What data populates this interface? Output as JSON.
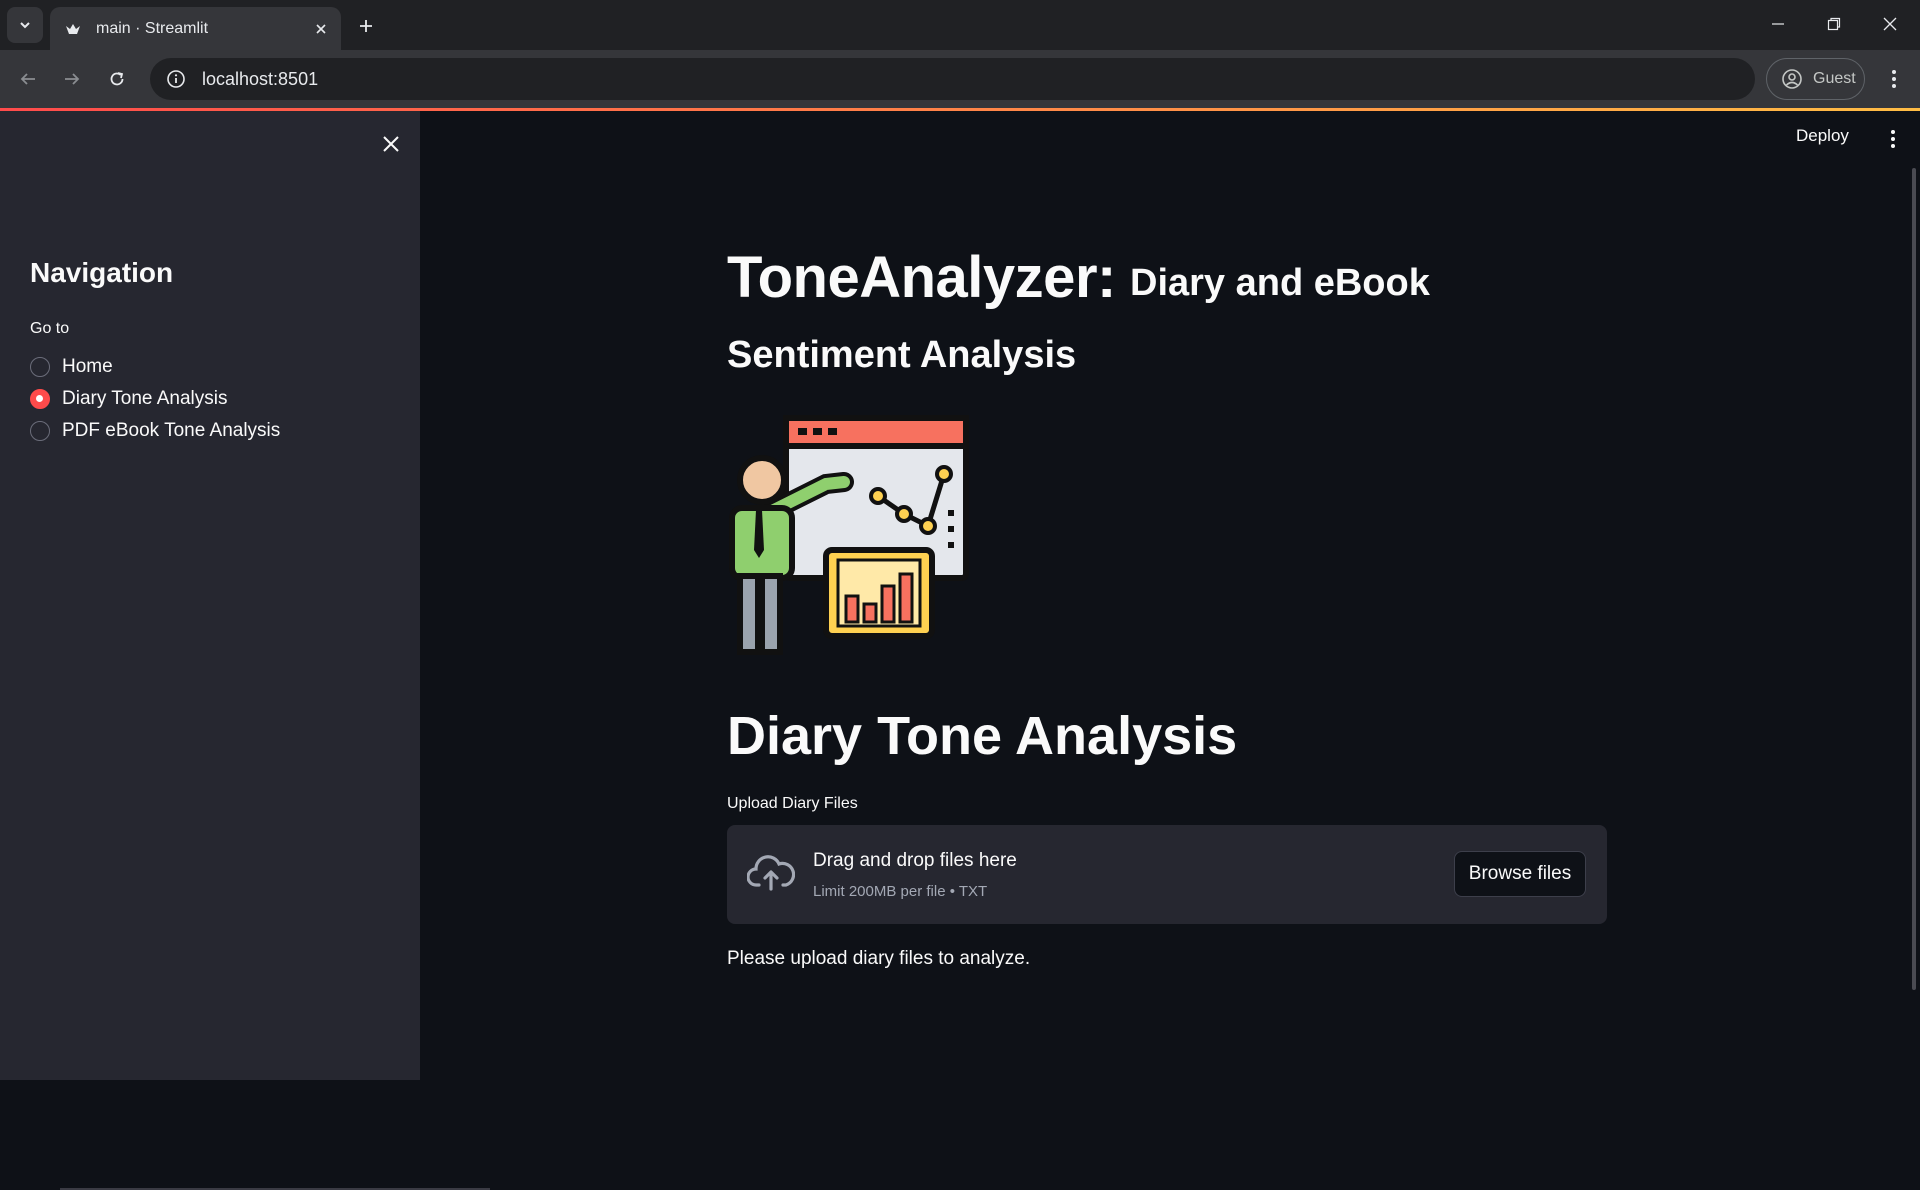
{
  "browser": {
    "tab_title": "main · Streamlit",
    "url": "localhost:8501",
    "profile_label": "Guest"
  },
  "sidebar": {
    "heading": "Navigation",
    "radio_label": "Go to",
    "options": [
      {
        "label": "Home",
        "selected": false
      },
      {
        "label": "Diary Tone Analysis",
        "selected": true
      },
      {
        "label": "PDF eBook Tone Analysis",
        "selected": false
      }
    ]
  },
  "header": {
    "deploy_label": "Deploy"
  },
  "main": {
    "title": "ToneAnalyzer:",
    "title_suffix": "Diary and eBook",
    "subtitle": "Sentiment Analysis",
    "section_title": "Diary Tone Analysis",
    "uploader": {
      "label": "Upload Diary Files",
      "drop_text": "Drag and drop files here",
      "limit_text": "Limit 200MB per file • TXT",
      "browse_label": "Browse files"
    },
    "info_message": "Please upload diary files to analyze."
  },
  "colors": {
    "accent": "#ff4b4b",
    "background": "#0e1117",
    "sidebar_bg": "#262730"
  }
}
